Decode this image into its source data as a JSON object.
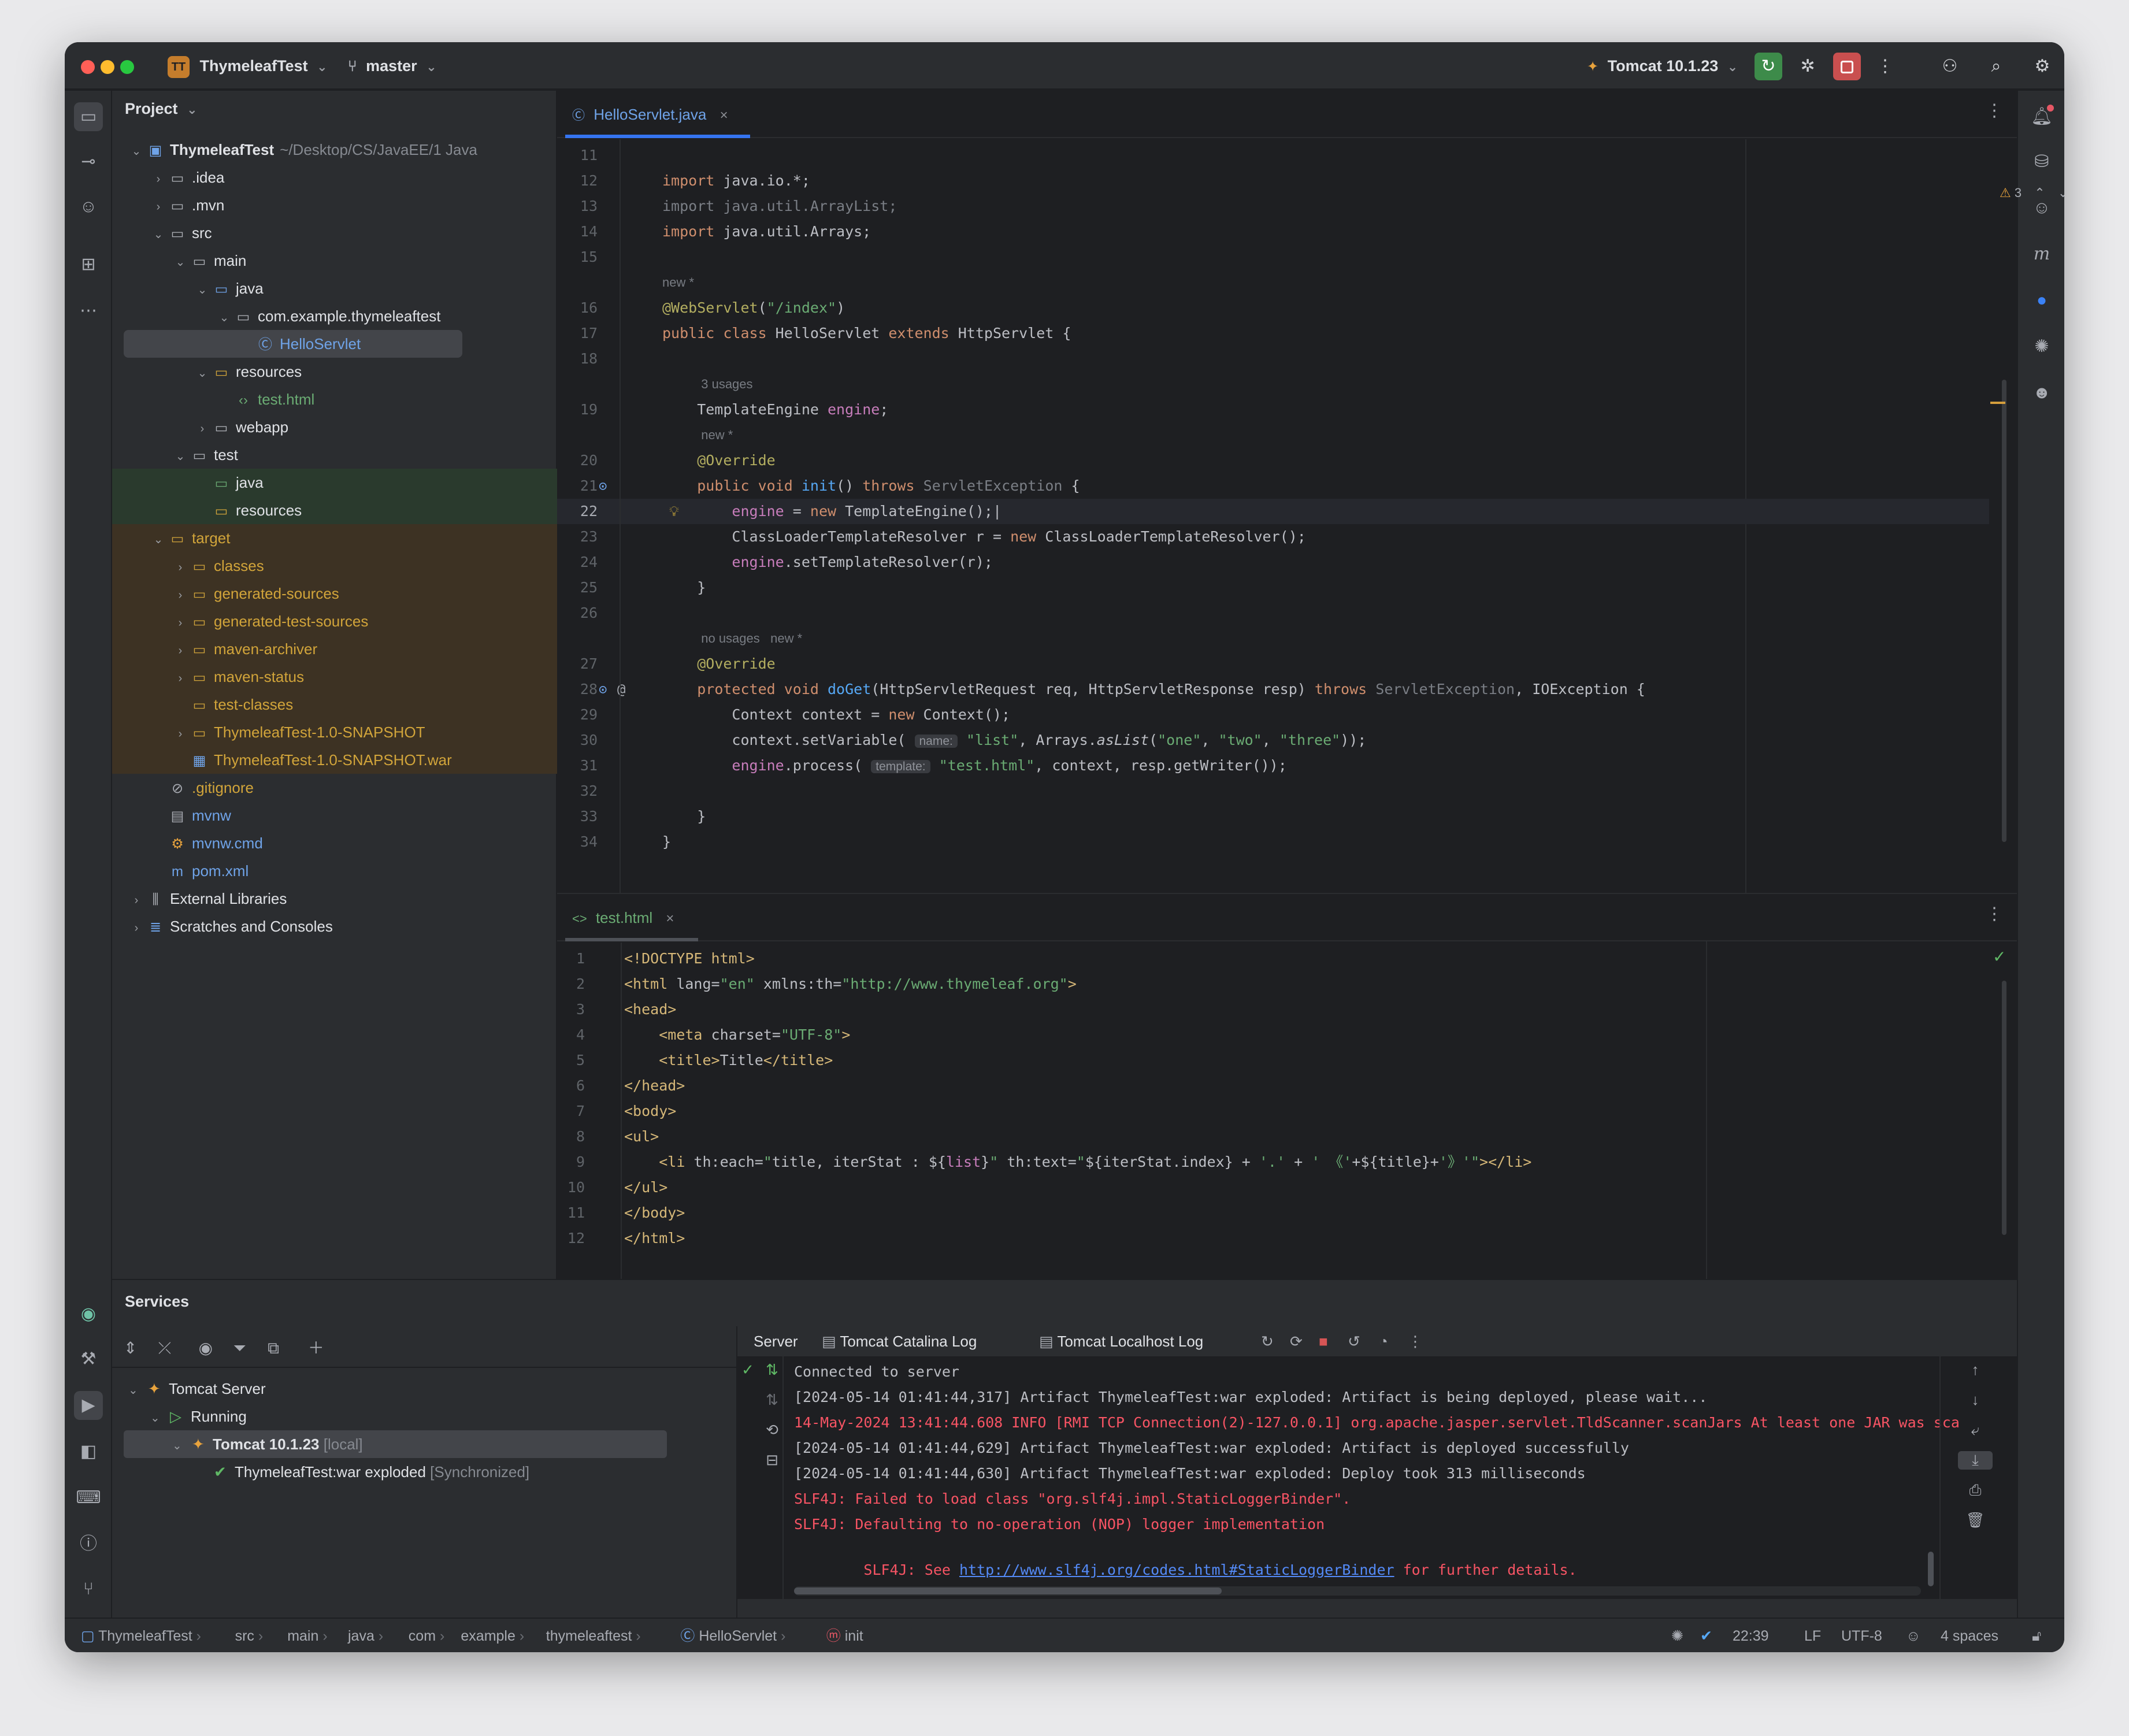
{
  "titlebar": {
    "project_badge": "TT",
    "project_name": "ThymeleafTest",
    "branch": "master",
    "run_config": "Tomcat 10.1.23"
  },
  "project_panel": {
    "title": "Project",
    "tree": [
      {
        "label": "ThymeleafTest",
        "extra": "~/Desktop/CS/JavaEE/1 Java",
        "indent": 0,
        "toggle": "v",
        "icon": "module",
        "color": "#dfe1e5",
        "bold": true,
        "bg": ""
      },
      {
        "label": ".idea",
        "extra": "",
        "indent": 1,
        "toggle": ">",
        "icon": "folder",
        "color": "#dfe1e5",
        "bold": false,
        "bg": ""
      },
      {
        "label": ".mvn",
        "extra": "",
        "indent": 1,
        "toggle": ">",
        "icon": "folder",
        "color": "#dfe1e5",
        "bold": false,
        "bg": ""
      },
      {
        "label": "src",
        "extra": "",
        "indent": 1,
        "toggle": "v",
        "icon": "folder",
        "color": "#dfe1e5",
        "bold": false,
        "bg": ""
      },
      {
        "label": "main",
        "extra": "",
        "indent": 2,
        "toggle": "v",
        "icon": "folder",
        "color": "#dfe1e5",
        "bold": false,
        "bg": ""
      },
      {
        "label": "java",
        "extra": "",
        "indent": 3,
        "toggle": "v",
        "icon": "folder-blue",
        "color": "#dfe1e5",
        "bold": false,
        "bg": ""
      },
      {
        "label": "com.example.thymeleaftest",
        "extra": "",
        "indent": 4,
        "toggle": "v",
        "icon": "package",
        "color": "#dfe1e5",
        "bold": false,
        "bg": ""
      },
      {
        "label": "HelloServlet",
        "extra": "",
        "indent": 5,
        "toggle": "",
        "icon": "class",
        "color": "#6fa3e8",
        "bold": false,
        "bg": "#43454a"
      },
      {
        "label": "resources",
        "extra": "",
        "indent": 3,
        "toggle": "v",
        "icon": "folder-res",
        "color": "#dfe1e5",
        "bold": false,
        "bg": ""
      },
      {
        "label": "test.html",
        "extra": "",
        "indent": 4,
        "toggle": "",
        "icon": "html",
        "color": "#6aab73",
        "bold": false,
        "bg": ""
      },
      {
        "label": "webapp",
        "extra": "",
        "indent": 3,
        "toggle": ">",
        "icon": "folder",
        "color": "#dfe1e5",
        "bold": false,
        "bg": ""
      },
      {
        "label": "test",
        "extra": "",
        "indent": 2,
        "toggle": "v",
        "icon": "folder",
        "color": "#dfe1e5",
        "bold": false,
        "bg": ""
      },
      {
        "label": "java",
        "extra": "",
        "indent": 3,
        "toggle": "",
        "icon": "folder-green",
        "color": "#dfe1e5",
        "bold": false,
        "bg": "#2a3a2d"
      },
      {
        "label": "resources",
        "extra": "",
        "indent": 3,
        "toggle": "",
        "icon": "folder-res",
        "color": "#dfe1e5",
        "bold": false,
        "bg": "#2a3a2d"
      },
      {
        "label": "target",
        "extra": "",
        "indent": 1,
        "toggle": "v",
        "icon": "folder-orange",
        "color": "#d1a43a",
        "bold": false,
        "bg": "#3d3223"
      },
      {
        "label": "classes",
        "extra": "",
        "indent": 2,
        "toggle": ">",
        "icon": "folder-orange",
        "color": "#d1a43a",
        "bold": false,
        "bg": "#3d3223"
      },
      {
        "label": "generated-sources",
        "extra": "",
        "indent": 2,
        "toggle": ">",
        "icon": "folder-orange",
        "color": "#d1a43a",
        "bold": false,
        "bg": "#3d3223"
      },
      {
        "label": "generated-test-sources",
        "extra": "",
        "indent": 2,
        "toggle": ">",
        "icon": "folder-orange",
        "color": "#d1a43a",
        "bold": false,
        "bg": "#3d3223"
      },
      {
        "label": "maven-archiver",
        "extra": "",
        "indent": 2,
        "toggle": ">",
        "icon": "folder-orange",
        "color": "#d1a43a",
        "bold": false,
        "bg": "#3d3223"
      },
      {
        "label": "maven-status",
        "extra": "",
        "indent": 2,
        "toggle": ">",
        "icon": "folder-orange",
        "color": "#d1a43a",
        "bold": false,
        "bg": "#3d3223"
      },
      {
        "label": "test-classes",
        "extra": "",
        "indent": 2,
        "toggle": "",
        "icon": "folder-orange",
        "color": "#d1a43a",
        "bold": false,
        "bg": "#3d3223"
      },
      {
        "label": "ThymeleafTest-1.0-SNAPSHOT",
        "extra": "",
        "indent": 2,
        "toggle": ">",
        "icon": "folder-orange",
        "color": "#d1a43a",
        "bold": false,
        "bg": "#3d3223"
      },
      {
        "label": "ThymeleafTest-1.0-SNAPSHOT.war",
        "extra": "",
        "indent": 2,
        "toggle": "",
        "icon": "war",
        "color": "#d1a43a",
        "bold": false,
        "bg": "#3d3223"
      },
      {
        "label": ".gitignore",
        "extra": "",
        "indent": 1,
        "toggle": "",
        "icon": "ignore",
        "color": "#d1a43a",
        "bold": false,
        "bg": ""
      },
      {
        "label": "mvnw",
        "extra": "",
        "indent": 1,
        "toggle": "",
        "icon": "terminal",
        "color": "#6fa3e8",
        "bold": false,
        "bg": ""
      },
      {
        "label": "mvnw.cmd",
        "extra": "",
        "indent": 1,
        "toggle": "",
        "icon": "cmd",
        "color": "#6fa3e8",
        "bold": false,
        "bg": ""
      },
      {
        "label": "pom.xml",
        "extra": "",
        "indent": 1,
        "toggle": "",
        "icon": "maven",
        "color": "#6fa3e8",
        "bold": false,
        "bg": ""
      },
      {
        "label": "External Libraries",
        "extra": "",
        "indent": 0,
        "toggle": ">",
        "icon": "library",
        "color": "#dfe1e5",
        "bold": false,
        "bg": ""
      },
      {
        "label": "Scratches and Consoles",
        "extra": "",
        "indent": 0,
        "toggle": ">",
        "icon": "scratch",
        "color": "#dfe1e5",
        "bold": false,
        "bg": ""
      }
    ]
  },
  "editor1": {
    "tab_label": "HelloServlet.java",
    "warnings": "3",
    "lines": [
      {
        "n": "11",
        "html": ""
      },
      {
        "n": "12",
        "html": "<span class='kw'>import</span> java.io.*;"
      },
      {
        "n": "13",
        "html": "<span class='gry'>import java.util.ArrayList;</span>"
      },
      {
        "n": "14",
        "html": "<span class='kw'>import</span> java.util.Arrays;"
      },
      {
        "n": "15",
        "html": ""
      },
      {
        "n": "",
        "hint": "new *"
      },
      {
        "n": "16",
        "html": "<span class='ann'>@WebServlet</span>(<span class='str'>\"/index\"</span>)"
      },
      {
        "n": "17",
        "html": "<span class='kw'>public class</span> HelloServlet <span class='kw'>extends</span> HttpServlet {"
      },
      {
        "n": "18",
        "html": ""
      },
      {
        "n": "",
        "hint": "    3 usages"
      },
      {
        "n": "19",
        "html": "    TemplateEngine <span class='fld'>engine</span>;"
      },
      {
        "n": "",
        "hint": "    new *"
      },
      {
        "n": "20",
        "html": "    <span class='ann'>@Override</span>"
      },
      {
        "n": "21",
        "html": "    <span class='kw'>public void</span> <span class='fn'>init</span>() <span class='kw'>throws</span> <span class='gry'>ServletException</span> {"
      },
      {
        "n": "22",
        "html": "        <span class='fld'>engine</span> = <span class='kw'>new</span> TemplateEngine();|"
      },
      {
        "n": "23",
        "html": "        ClassLoaderTemplateResolver r = <span class='kw'>new</span> ClassLoaderTemplateResolver();"
      },
      {
        "n": "24",
        "html": "        <span class='fld'>engine</span>.setTemplateResolver(r);"
      },
      {
        "n": "25",
        "html": "    }"
      },
      {
        "n": "26",
        "html": ""
      },
      {
        "n": "",
        "hint": "    no usages   new *"
      },
      {
        "n": "27",
        "html": "    <span class='ann'>@Override</span>"
      },
      {
        "n": "28",
        "html": "    <span class='kw'>protected void</span> <span class='fn'>doGet</span>(HttpServletRequest req, HttpServletResponse resp) <span class='kw'>throws</span> <span class='gry'>ServletException</span>, IOException {"
      },
      {
        "n": "29",
        "html": "        Context context = <span class='kw'>new</span> Context();"
      },
      {
        "n": "30",
        "html": "        context.setVariable( <span class='inl'>name:</span> <span class='str'>\"list\"</span>, Arrays.<i>asList</i>(<span class='str'>\"one\"</span>, <span class='str'>\"two\"</span>, <span class='str'>\"three\"</span>));"
      },
      {
        "n": "31",
        "html": "        <span class='fld'>engine</span>.process( <span class='inl'>template:</span> <span class='str'>\"test.html\"</span>, context, resp.getWriter());"
      },
      {
        "n": "32",
        "html": ""
      },
      {
        "n": "33",
        "html": "    }"
      },
      {
        "n": "34",
        "html": "}"
      }
    ]
  },
  "editor2": {
    "tab_label": "test.html",
    "lines": [
      {
        "n": "1",
        "html": "<span class='tag'>&lt;!DOCTYPE html&gt;</span>"
      },
      {
        "n": "2",
        "html": "<span class='tag'>&lt;html</span> <span class='attr'>lang=</span><span class='str'>\"en\"</span> <span class='attr'>xmlns:th=</span><span class='str'>\"http://www.thymeleaf.org\"</span><span class='tag'>&gt;</span>"
      },
      {
        "n": "3",
        "html": "<span class='tag'>&lt;head&gt;</span>"
      },
      {
        "n": "4",
        "html": "    <span class='tag'>&lt;meta</span> <span class='attr'>charset=</span><span class='str'>\"UTF-8\"</span><span class='tag'>&gt;</span>"
      },
      {
        "n": "5",
        "html": "    <span class='tag'>&lt;title&gt;</span>Title<span class='tag'>&lt;/title&gt;</span>"
      },
      {
        "n": "6",
        "html": "<span class='tag'>&lt;/head&gt;</span>"
      },
      {
        "n": "7",
        "html": "<span class='tag'>&lt;body&gt;</span>"
      },
      {
        "n": "8",
        "html": "<span class='tag'>&lt;ul&gt;</span>"
      },
      {
        "n": "9",
        "html": "    <span class='tag'>&lt;li</span> <span class='attr'>th:each=</span><span class='str'>\"</span>title, iterStat : ${<span class='fld'>list</span>}<span class='str'>\"</span> <span class='attr'>th:text=</span><span class='str'>\"</span>${iterStat.index} + <span class='str'>'.'</span> + <span class='str'>' 《'</span>+${title}+<span class='str'>'》'</span><span class='str'>\"</span><span class='tag'>&gt;&lt;/li&gt;</span>"
      },
      {
        "n": "10",
        "html": "<span class='tag'>&lt;/ul&gt;</span>"
      },
      {
        "n": "11",
        "html": "<span class='tag'>&lt;/body&gt;</span>"
      },
      {
        "n": "12",
        "html": "<span class='tag'>&lt;/html&gt;</span>"
      }
    ]
  },
  "services": {
    "title": "Services",
    "tree": [
      {
        "label": "Tomcat Server",
        "extra": "",
        "indent": 0,
        "toggle": "v",
        "bold": false,
        "bg": ""
      },
      {
        "label": "Running",
        "extra": "",
        "indent": 1,
        "toggle": "v",
        "bold": false,
        "bg": ""
      },
      {
        "label": "Tomcat 10.1.23",
        "extra": "[local]",
        "indent": 2,
        "toggle": "v",
        "bold": true,
        "bg": "#43454a"
      },
      {
        "label": "ThymeleafTest:war exploded",
        "extra": "[Synchronized]",
        "indent": 3,
        "toggle": "",
        "bold": false,
        "bg": ""
      }
    ],
    "tabs": [
      "Server",
      "Tomcat Catalina Log",
      "Tomcat Localhost Log"
    ],
    "console": [
      {
        "text": "Connected to server",
        "cls": ""
      },
      {
        "text": "[2024-05-14 01:41:44,317] Artifact ThymeleafTest:war exploded: Artifact is being deployed, please wait...",
        "cls": ""
      },
      {
        "text": "14-May-2024 13:41:44.608 INFO [RMI TCP Connection(2)-127.0.0.1] org.apache.jasper.servlet.TldScanner.scanJars At least one JAR was sca",
        "cls": "err"
      },
      {
        "text": "[2024-05-14 01:41:44,629] Artifact ThymeleafTest:war exploded: Artifact is deployed successfully",
        "cls": ""
      },
      {
        "text": "[2024-05-14 01:41:44,630] Artifact ThymeleafTest:war exploded: Deploy took 313 milliseconds",
        "cls": ""
      },
      {
        "text": "SLF4J: Failed to load class \"org.slf4j.impl.StaticLoggerBinder\".",
        "cls": "err"
      },
      {
        "text": "SLF4J: Defaulting to no-operation (NOP) logger implementation",
        "cls": "err"
      }
    ],
    "console_link_prefix": "SLF4J: See ",
    "console_link": "http://www.slf4j.org/codes.html#StaticLoggerBinder",
    "console_link_suffix": " for further details."
  },
  "statusbar": {
    "breadcrumbs": [
      "ThymeleafTest",
      "src",
      "main",
      "java",
      "com",
      "example",
      "thymeleaftest",
      "HelloServlet",
      "init"
    ],
    "position": "22:39",
    "line_sep": "LF",
    "encoding": "UTF-8",
    "indent": "4 spaces"
  }
}
